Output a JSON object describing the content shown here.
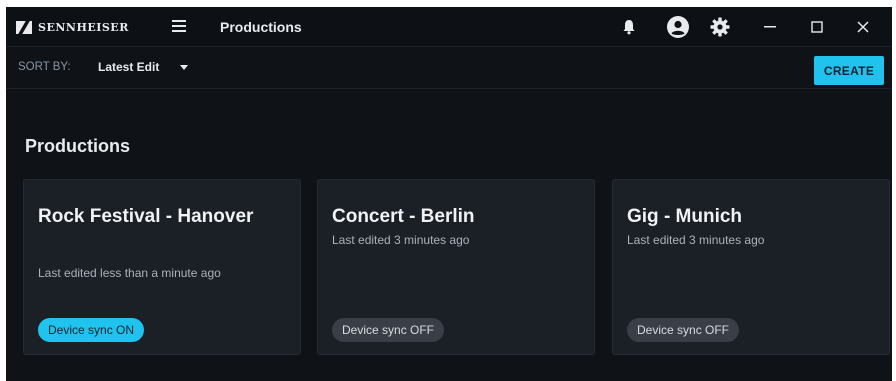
{
  "header": {
    "brand": "SENNHEISER",
    "title": "Productions",
    "icons": [
      "bell-icon",
      "account-icon",
      "gear-icon",
      "minimize-icon",
      "maximize-icon",
      "close-icon"
    ]
  },
  "toolbar": {
    "sort_label": "SORT BY:",
    "sort_value": "Latest Edit",
    "create_label": "CREATE"
  },
  "main": {
    "section_title": "Productions",
    "cards": [
      {
        "title": "Rock Festival - Hanover",
        "subtitle": "Last edited less than a minute ago",
        "sync": "Device sync ON"
      },
      {
        "title": "Concert - Berlin",
        "subtitle": "Last edited 3 minutes ago",
        "sync": "Device sync OFF"
      },
      {
        "title": "Gig - Munich",
        "subtitle": "Last edited 3 minutes ago",
        "sync": "Device sync OFF"
      }
    ]
  },
  "colors": {
    "accent": "#1fc3ee",
    "background": "#0f1318",
    "card": "#1b1f26",
    "badge_off": "#3a3f47"
  }
}
